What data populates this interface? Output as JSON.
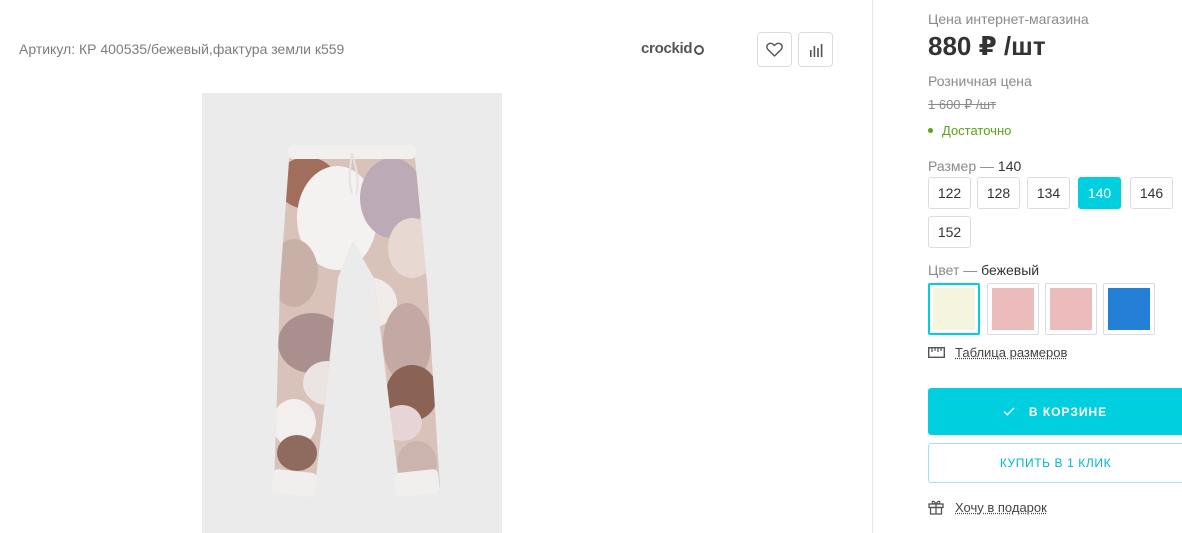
{
  "product": {
    "article": "Артикул: КР 400535/бежевый,фактура земли к559",
    "brand": "crockid",
    "image_icon": "pants-image"
  },
  "actions": {
    "favorite_icon": "heart-icon",
    "compare_icon": "bar-chart-icon"
  },
  "pricing": {
    "online_label": "Цена интернет-магазина",
    "online_price": "880 ₽ /шт",
    "retail_label": "Розничная цена",
    "retail_price": "1 600 ₽ /шт",
    "stock_status": "Достаточно",
    "stock_color": "#5aa31c"
  },
  "size": {
    "label": "Размер",
    "separator": "—",
    "selected": "140",
    "options": [
      "122",
      "128",
      "134",
      "140",
      "146",
      "152"
    ]
  },
  "color": {
    "label": "Цвет",
    "separator": "—",
    "selected": "бежевый",
    "swatches": [
      "#f5f5df",
      "#ecbcbc",
      "#ecbcbc",
      "#2480d6"
    ]
  },
  "size_table": {
    "label": "Таблица размеров",
    "icon": "ruler-icon"
  },
  "buttons": {
    "in_cart": "В КОРЗИНЕ",
    "in_cart_icon": "check-icon",
    "buy_one_click": "КУПИТЬ В 1 КЛИК"
  },
  "gift": {
    "label": "Хочу в подарок",
    "icon": "gift-icon"
  },
  "accent_color": "#00cfe0"
}
